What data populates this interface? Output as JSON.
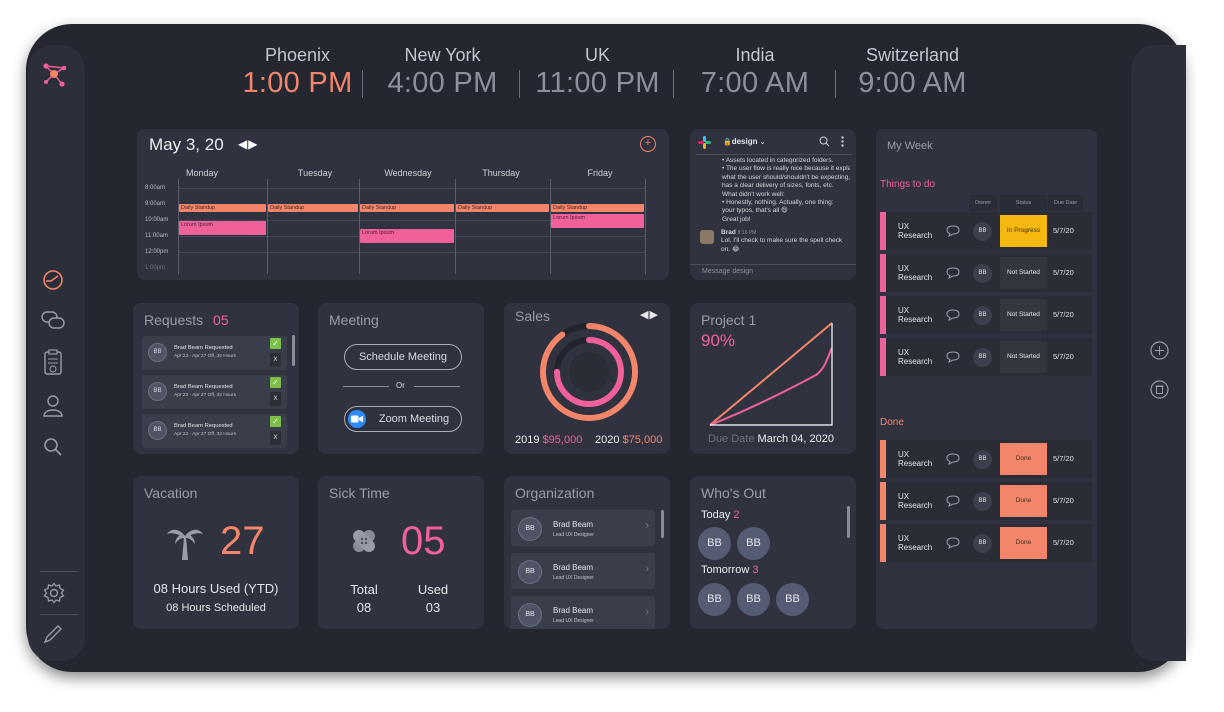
{
  "clocks": [
    {
      "city": "Phoenix",
      "time": "1:00 PM",
      "active": true
    },
    {
      "city": "New York",
      "time": "4:00 PM"
    },
    {
      "city": "UK",
      "time": "11:00 PM"
    },
    {
      "city": "India",
      "time": "7:00 AM"
    },
    {
      "city": "Switzerland",
      "time": "9:00 AM"
    }
  ],
  "calendar": {
    "date": "May 3, 20",
    "arrows": "◀▶",
    "add": "+",
    "days": [
      "Monday",
      "Tuesday",
      "Wednesday",
      "Thursday",
      "Friday"
    ],
    "hours": [
      "8:00am",
      "9:00am",
      "10:00am",
      "11:00am",
      "12:00pm",
      "1:00pm"
    ],
    "standup": "Daily Standup",
    "lorem": "Lorum Ipsum"
  },
  "slack": {
    "channel": "design",
    "caret": "⌄",
    "messages": [
      "• Assets located in categorized folders.",
      "• The user flow is really nice because it explains",
      "what the user should/shouldn't be expecting,",
      "has a clear delivery of sizes, fonts, etc.",
      "What didn't work well:",
      "• Honestly, nothing. Actually, one thing:",
      "your typos, that's all 😄",
      "Great job!"
    ],
    "strike": "Honestly, nothing.",
    "author": "Brad",
    "author_time": "8:16 PM",
    "reply": "Lol, I'll check to make sure the spell check on. 😂",
    "placeholder": "Message design"
  },
  "week": {
    "title": "My Week",
    "todo_label": "Things to do",
    "done_label": "Done",
    "headers": [
      "Owner",
      "Status",
      "Due Date"
    ],
    "task": "UX Research",
    "owner": "BB",
    "todo": [
      {
        "status": "In Progress",
        "due": "5/7/20",
        "color": "#f5b80f"
      },
      {
        "status": "Not Started",
        "due": "5/7/20"
      },
      {
        "status": "Not Started",
        "due": "5/7/20"
      },
      {
        "status": "Not Started",
        "due": "5/7/20"
      }
    ],
    "done": [
      {
        "status": "Done",
        "due": "5/7/20"
      },
      {
        "status": "Done",
        "due": "5/7/20"
      },
      {
        "status": "Done",
        "due": "5/7/20"
      }
    ]
  },
  "requests": {
    "title": "Requests",
    "count": "05",
    "name": "Brad Beam Requested",
    "dates": "Apr 23 - Apr 27 Off,   32 Hours",
    "avatar": "BB",
    "approve": "✓",
    "deny": "X"
  },
  "meeting": {
    "title": "Meeting",
    "schedule": "Schedule  Meeting",
    "or": "Or",
    "zoom": "Zoom Meeting"
  },
  "sales": {
    "title": "Sales",
    "arrows": "◀▶",
    "y2019": "2019",
    "v2019": "$95,000",
    "y2020": "2020",
    "v2020": "$75,000",
    "progress_outer": 0.9,
    "progress_inner": 0.75
  },
  "project": {
    "title": "Project 1",
    "percent": "90%",
    "due_label": "Due Date",
    "due_date": "March 04, 2020"
  },
  "vacation": {
    "title": "Vacation",
    "days": "27",
    "used": "08 Hours Used (YTD)",
    "scheduled": "08 Hours Scheduled"
  },
  "sick": {
    "title": "Sick Time",
    "days": "05",
    "total_label": "Total",
    "total": "08",
    "used_label": "Used",
    "used": "03"
  },
  "org": {
    "title": "Organization",
    "name": "Brad Beam",
    "role": "Lead UX Designer",
    "avatar": "BB",
    "chevron": "›"
  },
  "whosout": {
    "title": "Who's Out",
    "today_label": "Today",
    "today_count": "2",
    "tomorrow_label": "Tomorrow",
    "tomorrow_count": "3",
    "avatar": "BB"
  },
  "colors": {
    "accent_orange": "#f2856a",
    "accent_pink": "#f0609a",
    "yellow": "#f5b80f",
    "card": "#30333f",
    "background": "#242630"
  }
}
